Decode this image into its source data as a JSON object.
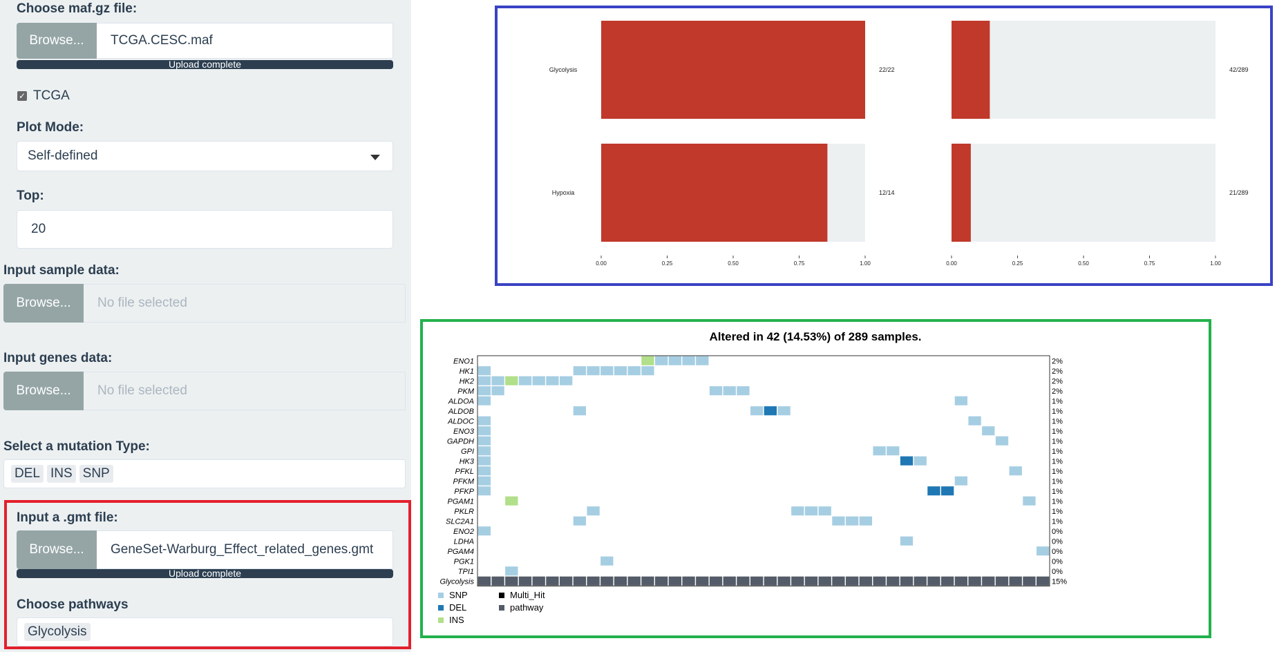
{
  "sidebar": {
    "maf": {
      "label": "Choose maf.gz file:",
      "browse_label": "Browse...",
      "filename": "TCGA.CESC.maf",
      "progress_text": "Upload complete"
    },
    "tcga_checkbox": {
      "label": "TCGA",
      "checked": true
    },
    "plot_mode": {
      "label": "Plot Mode:",
      "value": "Self-defined"
    },
    "top": {
      "label": "Top:",
      "value": "20"
    },
    "sample_data": {
      "label": "Input sample data:",
      "browse_label": "Browse...",
      "placeholder": "No file selected"
    },
    "genes_data": {
      "label": "Input genes data:",
      "browse_label": "Browse...",
      "placeholder": "No file selected"
    },
    "mutation_type": {
      "label": "Select a mutation Type:",
      "chips": [
        "DEL",
        "INS",
        "SNP"
      ]
    },
    "gmt": {
      "label": "Input a .gmt file:",
      "browse_label": "Browse...",
      "filename": "GeneSet-Warburg_Effect_related_genes.gmt",
      "progress_text": "Upload complete"
    },
    "pathways": {
      "label": "Choose pathways",
      "chips": [
        "Glycolysis"
      ]
    }
  },
  "colors": {
    "bar_fill": "#c0392b",
    "bar_bg": "#ecf0f1",
    "snp": "#a6cee3",
    "del": "#1f78b4",
    "ins": "#b2df8a",
    "multi_hit": "#000000",
    "pathway": "#535c68",
    "accent_blue_border": "#3a43c4",
    "accent_green_border": "#22b14c",
    "accent_red_border": "#e2202c"
  },
  "chart_data": [
    {
      "type": "bar",
      "orientation": "horizontal",
      "categories": [
        "Glycolysis",
        "Hypoxia"
      ],
      "panels": [
        {
          "values": [
            1.0,
            0.857
          ],
          "labels": [
            "22/22",
            "12/14"
          ]
        },
        {
          "values": [
            0.145,
            0.073
          ],
          "labels": [
            "42/289",
            "21/289"
          ]
        }
      ],
      "xlim": [
        0,
        1
      ],
      "xticks": [
        "0.00",
        "0.25",
        "0.50",
        "0.75",
        "1.00"
      ]
    },
    {
      "type": "heatmap",
      "title": "Altered in 42 (14.53%) of 289 samples.",
      "n_columns": 42,
      "genes": [
        "ENO1",
        "HK1",
        "HK2",
        "PKM",
        "ALDOA",
        "ALDOB",
        "ALDOC",
        "ENO3",
        "GAPDH",
        "GPI",
        "HK3",
        "PFKL",
        "PFKM",
        "PFKP",
        "PGAM1",
        "PKLR",
        "SLC2A1",
        "ENO2",
        "LDHA",
        "PGAM4",
        "PGK1",
        "TPI1"
      ],
      "percents": [
        "2%",
        "2%",
        "2%",
        "2%",
        "1%",
        "1%",
        "1%",
        "1%",
        "1%",
        "1%",
        "1%",
        "1%",
        "1%",
        "1%",
        "1%",
        "1%",
        "1%",
        "0%",
        "0%",
        "0%",
        "0%",
        "0%"
      ],
      "pathway_row": {
        "name": "Glycolysis",
        "percent": "15%"
      },
      "mutations": [
        [
          [
            12,
            "INS"
          ],
          [
            13,
            "SNP"
          ],
          [
            14,
            "SNP"
          ],
          [
            15,
            "SNP"
          ],
          [
            16,
            "SNP"
          ]
        ],
        [
          [
            0,
            "SNP"
          ],
          [
            7,
            "SNP"
          ],
          [
            8,
            "SNP"
          ],
          [
            9,
            "SNP"
          ],
          [
            10,
            "SNP"
          ],
          [
            11,
            "SNP"
          ],
          [
            12,
            "SNP"
          ]
        ],
        [
          [
            0,
            "SNP"
          ],
          [
            1,
            "SNP"
          ],
          [
            2,
            "INS"
          ],
          [
            3,
            "SNP"
          ],
          [
            4,
            "SNP"
          ],
          [
            5,
            "SNP"
          ],
          [
            6,
            "SNP"
          ]
        ],
        [
          [
            0,
            "SNP"
          ],
          [
            1,
            "SNP"
          ],
          [
            17,
            "SNP"
          ],
          [
            18,
            "SNP"
          ],
          [
            19,
            "SNP"
          ]
        ],
        [
          [
            0,
            "SNP"
          ],
          [
            35,
            "SNP"
          ]
        ],
        [
          [
            7,
            "SNP"
          ],
          [
            20,
            "SNP"
          ],
          [
            21,
            "DEL"
          ],
          [
            22,
            "SNP"
          ]
        ],
        [
          [
            0,
            "SNP"
          ],
          [
            36,
            "SNP"
          ]
        ],
        [
          [
            0,
            "SNP"
          ],
          [
            37,
            "SNP"
          ]
        ],
        [
          [
            0,
            "SNP"
          ],
          [
            38,
            "SNP"
          ]
        ],
        [
          [
            0,
            "SNP"
          ],
          [
            29,
            "SNP"
          ],
          [
            30,
            "SNP"
          ]
        ],
        [
          [
            0,
            "SNP"
          ],
          [
            31,
            "DEL"
          ],
          [
            32,
            "SNP"
          ]
        ],
        [
          [
            0,
            "SNP"
          ],
          [
            39,
            "SNP"
          ]
        ],
        [
          [
            0,
            "SNP"
          ],
          [
            35,
            "SNP"
          ]
        ],
        [
          [
            0,
            "SNP"
          ],
          [
            33,
            "DEL"
          ],
          [
            34,
            "DEL"
          ]
        ],
        [
          [
            2,
            "INS"
          ],
          [
            40,
            "SNP"
          ]
        ],
        [
          [
            8,
            "SNP"
          ],
          [
            23,
            "SNP"
          ],
          [
            24,
            "SNP"
          ],
          [
            25,
            "SNP"
          ]
        ],
        [
          [
            7,
            "SNP"
          ],
          [
            26,
            "SNP"
          ],
          [
            27,
            "SNP"
          ],
          [
            28,
            "SNP"
          ]
        ],
        [
          [
            0,
            "SNP"
          ]
        ],
        [
          [
            31,
            "SNP"
          ]
        ],
        [
          [
            41,
            "SNP"
          ]
        ],
        [
          [
            9,
            "SNP"
          ]
        ],
        [
          [
            2,
            "SNP"
          ]
        ]
      ],
      "legend": [
        "SNP",
        "DEL",
        "INS",
        "Multi_Hit",
        "pathway"
      ]
    }
  ]
}
